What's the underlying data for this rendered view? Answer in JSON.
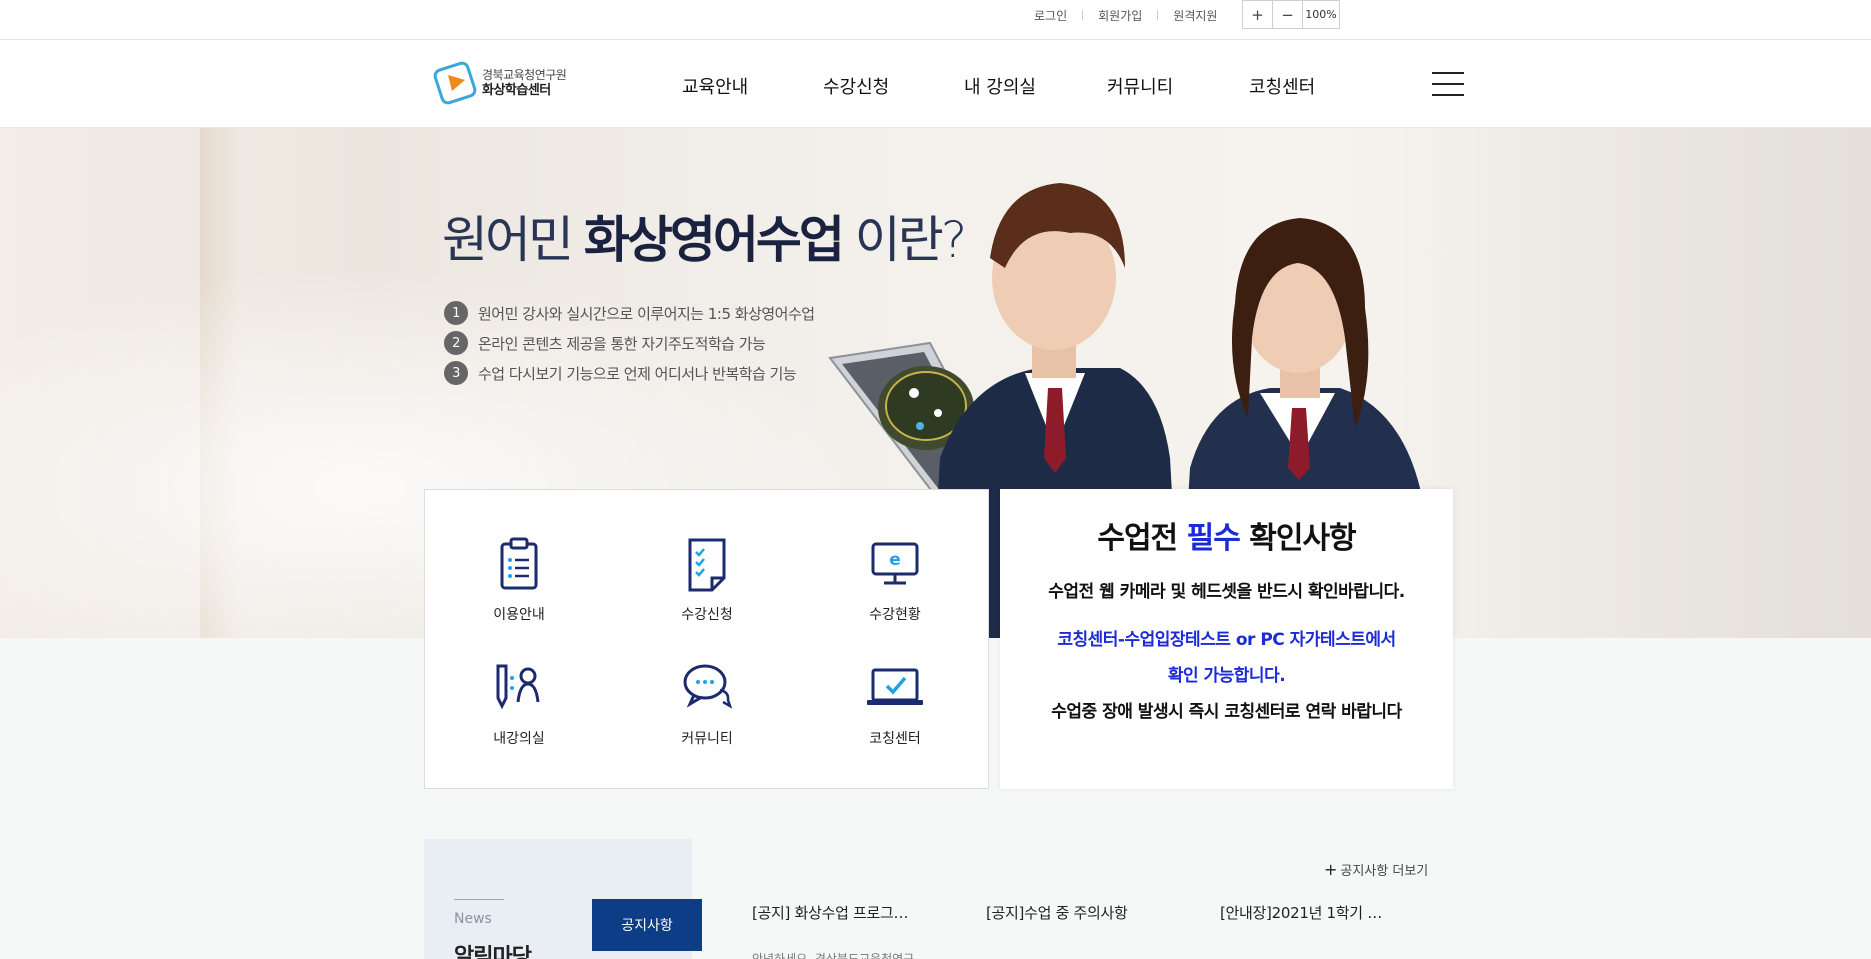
{
  "util": {
    "login": "로그인",
    "signup": "회원가입",
    "remote": "원격지원",
    "zoom_in": "+",
    "zoom_out": "−",
    "zoom_level": "100%"
  },
  "logo": {
    "line1": "경북교육청연구원",
    "line2": "화상학습센터"
  },
  "nav": {
    "items": [
      "교육안내",
      "수강신청",
      "내 강의실",
      "커뮤니티",
      "코칭센터"
    ]
  },
  "hero": {
    "title_a": "원어민 ",
    "title_b": "화상영어수업",
    "title_c": " 이란?",
    "points": [
      {
        "num": "1",
        "text": "원어민 강사와 실시간으로 이루어지는 1:5 화상영어수업"
      },
      {
        "num": "2",
        "text": "온라인 콘텐츠 제공을 통한 자기주도적학습 가능"
      },
      {
        "num": "3",
        "text": "수업 다시보기 기능으로 언제 어디서나 반복학습 기능"
      }
    ]
  },
  "quick": {
    "items": [
      {
        "label": "이용안내",
        "icon": "clipboard-list-icon"
      },
      {
        "label": "수강신청",
        "icon": "checklist-document-icon"
      },
      {
        "label": "수강현황",
        "icon": "monitor-e-icon"
      },
      {
        "label": "내강의실",
        "icon": "pencil-person-icon"
      },
      {
        "label": "커뮤니티",
        "icon": "chat-bubbles-icon"
      },
      {
        "label": "코칭센터",
        "icon": "laptop-check-icon"
      }
    ]
  },
  "notice_box": {
    "title_a": "수업전 ",
    "title_b": "필수",
    "title_c": " 확인사항",
    "line1": "수업전 웹 카메라 및 헤드셋을 반드시 확인바랍니다.",
    "line2": "코칭센터-수업입장테스트 or PC 자가테스트에서",
    "line3": "확인 가능합니다.",
    "line4": "수업중 장애 발생시 즉시 코칭센터로 연락 바랍니다"
  },
  "board": {
    "news_label": "News",
    "title": "알림마당",
    "tab": "공지사항",
    "more": "공지사항 더보기",
    "items": [
      "[공지] 화상수업 프로그…",
      "[공지]수업 중 주의사항",
      "[안내장]2021년 1학기 …"
    ],
    "sub": "안녕하세요. 경상북도교육청연구"
  },
  "colors": {
    "navy": "#0d3d86",
    "accent_blue": "#1d2bd6",
    "icon_navy": "#1c2a6e",
    "icon_accent": "#1fa3e8"
  }
}
